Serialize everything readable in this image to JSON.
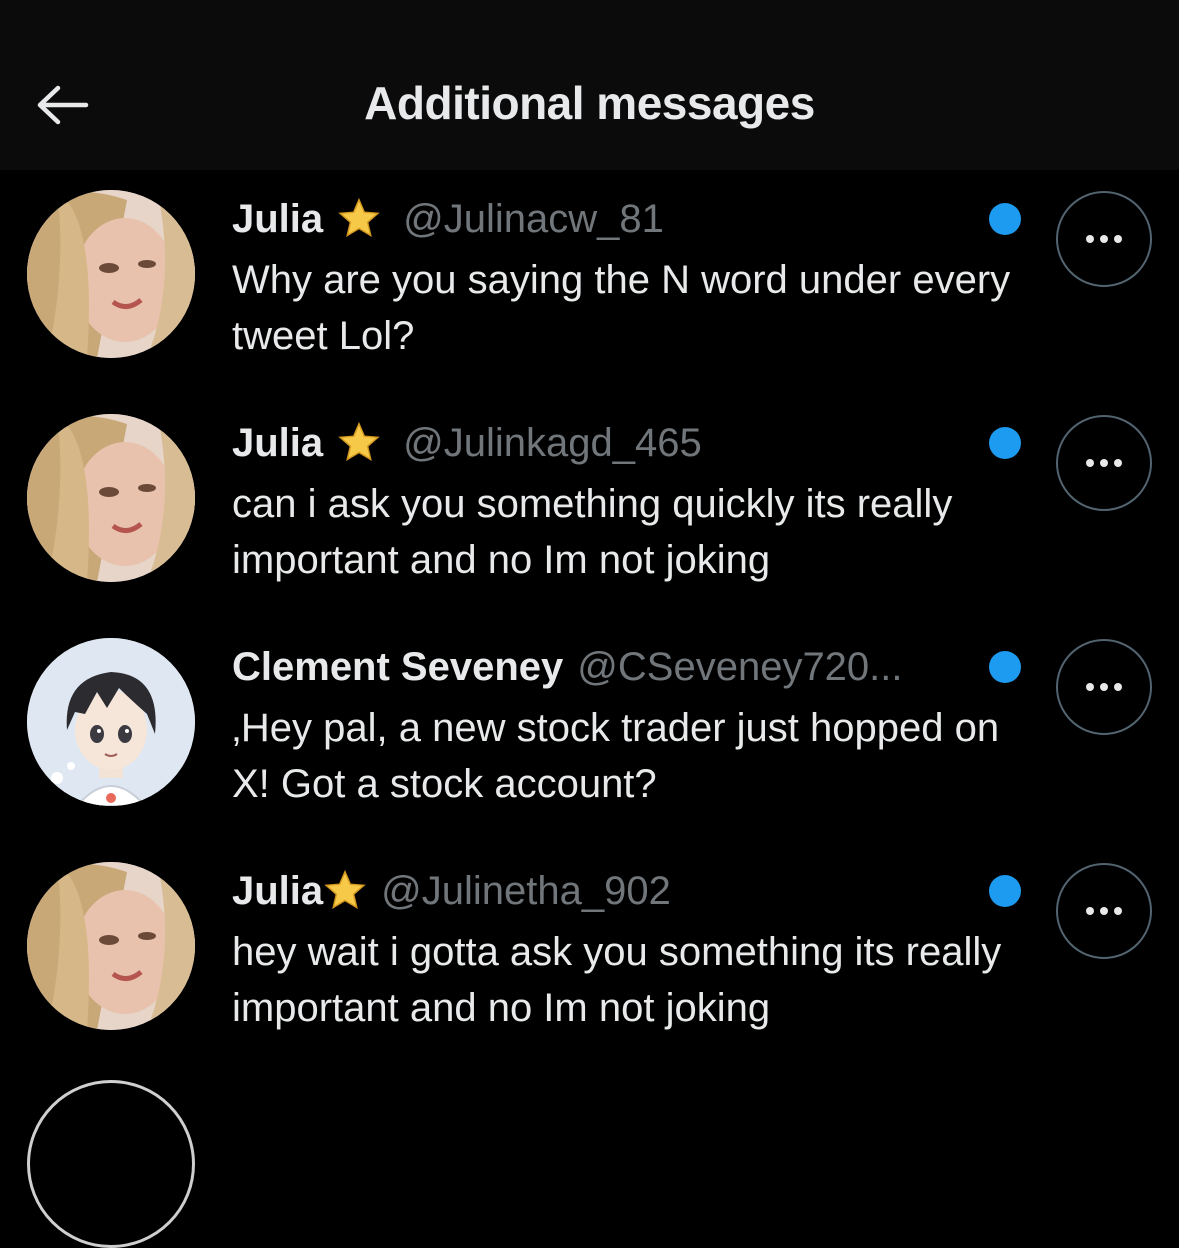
{
  "header": {
    "title": "Additional messages",
    "back_icon": "arrow-left-icon"
  },
  "messages": [
    {
      "name": "Julia",
      "badge": "star-icon",
      "handle": "@Julinacw_81",
      "text": "Why are you saying the N word under every tweet Lol?",
      "unread": true
    },
    {
      "name": "Julia",
      "badge": "star-icon",
      "handle": "@Julinkagd_465",
      "text": "can i ask you something quickly its really important and no Im not joking",
      "unread": true
    },
    {
      "name": "Clement Seveney",
      "handle": "@CSeveney720...",
      "text": "‚Hey pal, a new stock trader just hopped on X! Got a stock account?",
      "unread": true
    },
    {
      "name": "Julia",
      "badge": "star-icon",
      "handle": "@Julinetha_902",
      "text": "hey wait i gotta ask you something its really important and no Im not joking",
      "unread": true
    }
  ],
  "colors": {
    "background": "#000000",
    "header_background": "#0b0b0b",
    "text_primary": "#e7e9ea",
    "text_secondary": "#71767b",
    "unread_dot": "#1d9bf0"
  }
}
